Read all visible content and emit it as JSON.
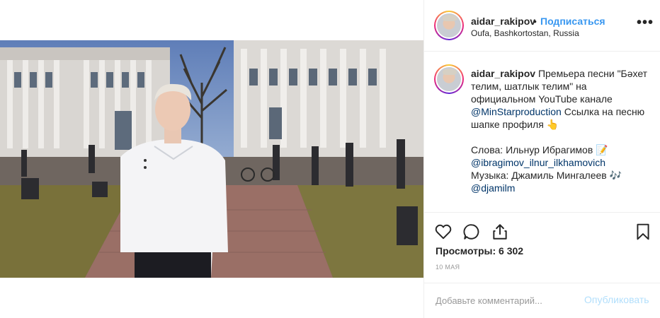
{
  "header": {
    "username": "aidar_rakipov",
    "separator": "•",
    "follow_label": "Подписаться",
    "location": "Oufa, Bashkortostan, Russia",
    "more_glyph": "•••"
  },
  "caption": {
    "username": "aidar_rakipov",
    "part1": " Премьера песни \"Бәхет телим, шатлык телим\" на официальном YouTube канале ",
    "mention1": "@MinStarproduction",
    "part2": " Ссылка на песню шапке профиля 👆\n\nСлова: Ильнур Ибрагимов 📝\n",
    "mention2": "@ibragimov_ilnur_ilkhamovich",
    "part3": "\nМузыка: Джамиль Мингалеев 🎶\n",
    "mention3": "@djamilm"
  },
  "actions": {
    "icons": [
      "heart-icon",
      "comment-icon",
      "share-icon",
      "bookmark-icon"
    ]
  },
  "views": "Просмотры: 6 302",
  "date": "10 мая",
  "comment": {
    "placeholder": "Добавьте комментарий...",
    "publish_label": "Опубликовать"
  },
  "colors": {
    "link": "#3897f0",
    "mention": "#003569",
    "publish_disabled": "#b2dffc",
    "muted": "#999999",
    "border": "#efefef"
  }
}
